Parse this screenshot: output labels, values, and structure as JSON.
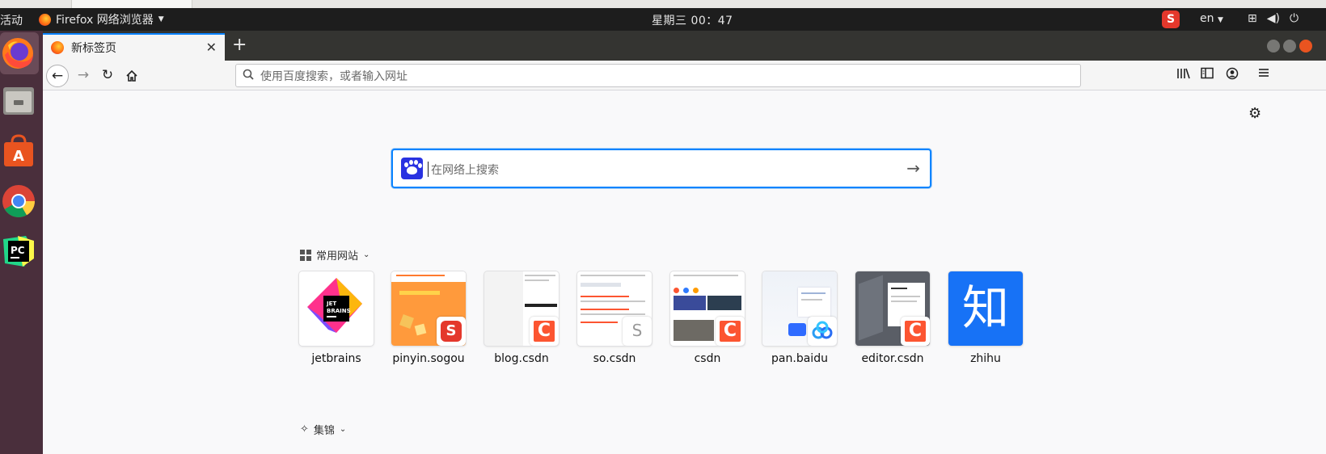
{
  "gnome": {
    "activities": "活动",
    "app_menu": "Firefox 网络浏览器",
    "clock": "星期三 00：47",
    "ime_label": "S",
    "lang": "en"
  },
  "browser": {
    "tab_title": "新标签页",
    "urlbar_placeholder": "使用百度搜索，或者输入网址"
  },
  "newtab": {
    "search_placeholder": "在网络上搜索",
    "top_sites_title": "常用网站",
    "highlights_title": "集锦",
    "tiles": [
      {
        "label": "jetbrains"
      },
      {
        "label": "pinyin.sogou"
      },
      {
        "label": "blog.csdn"
      },
      {
        "label": "so.csdn"
      },
      {
        "label": "csdn"
      },
      {
        "label": "pan.baidu"
      },
      {
        "label": "editor.csdn"
      },
      {
        "label": "zhihu"
      }
    ],
    "jetbrains_logo_text": "JET BRAINS",
    "zhihu_char": "知"
  },
  "colors": {
    "accent": "#0a84ff",
    "csdn": "#fc5531",
    "sogou": "#e4382c",
    "zhihu": "#1772f6",
    "dock": "#4a2f3c"
  },
  "icons": [
    "firefox-icon",
    "files-icon",
    "software-icon",
    "chrome-icon",
    "pycharm-icon",
    "gear-icon",
    "search-icon",
    "home-icon",
    "reload-icon",
    "library-icon",
    "sidebar-icon",
    "account-icon",
    "menu-icon"
  ]
}
